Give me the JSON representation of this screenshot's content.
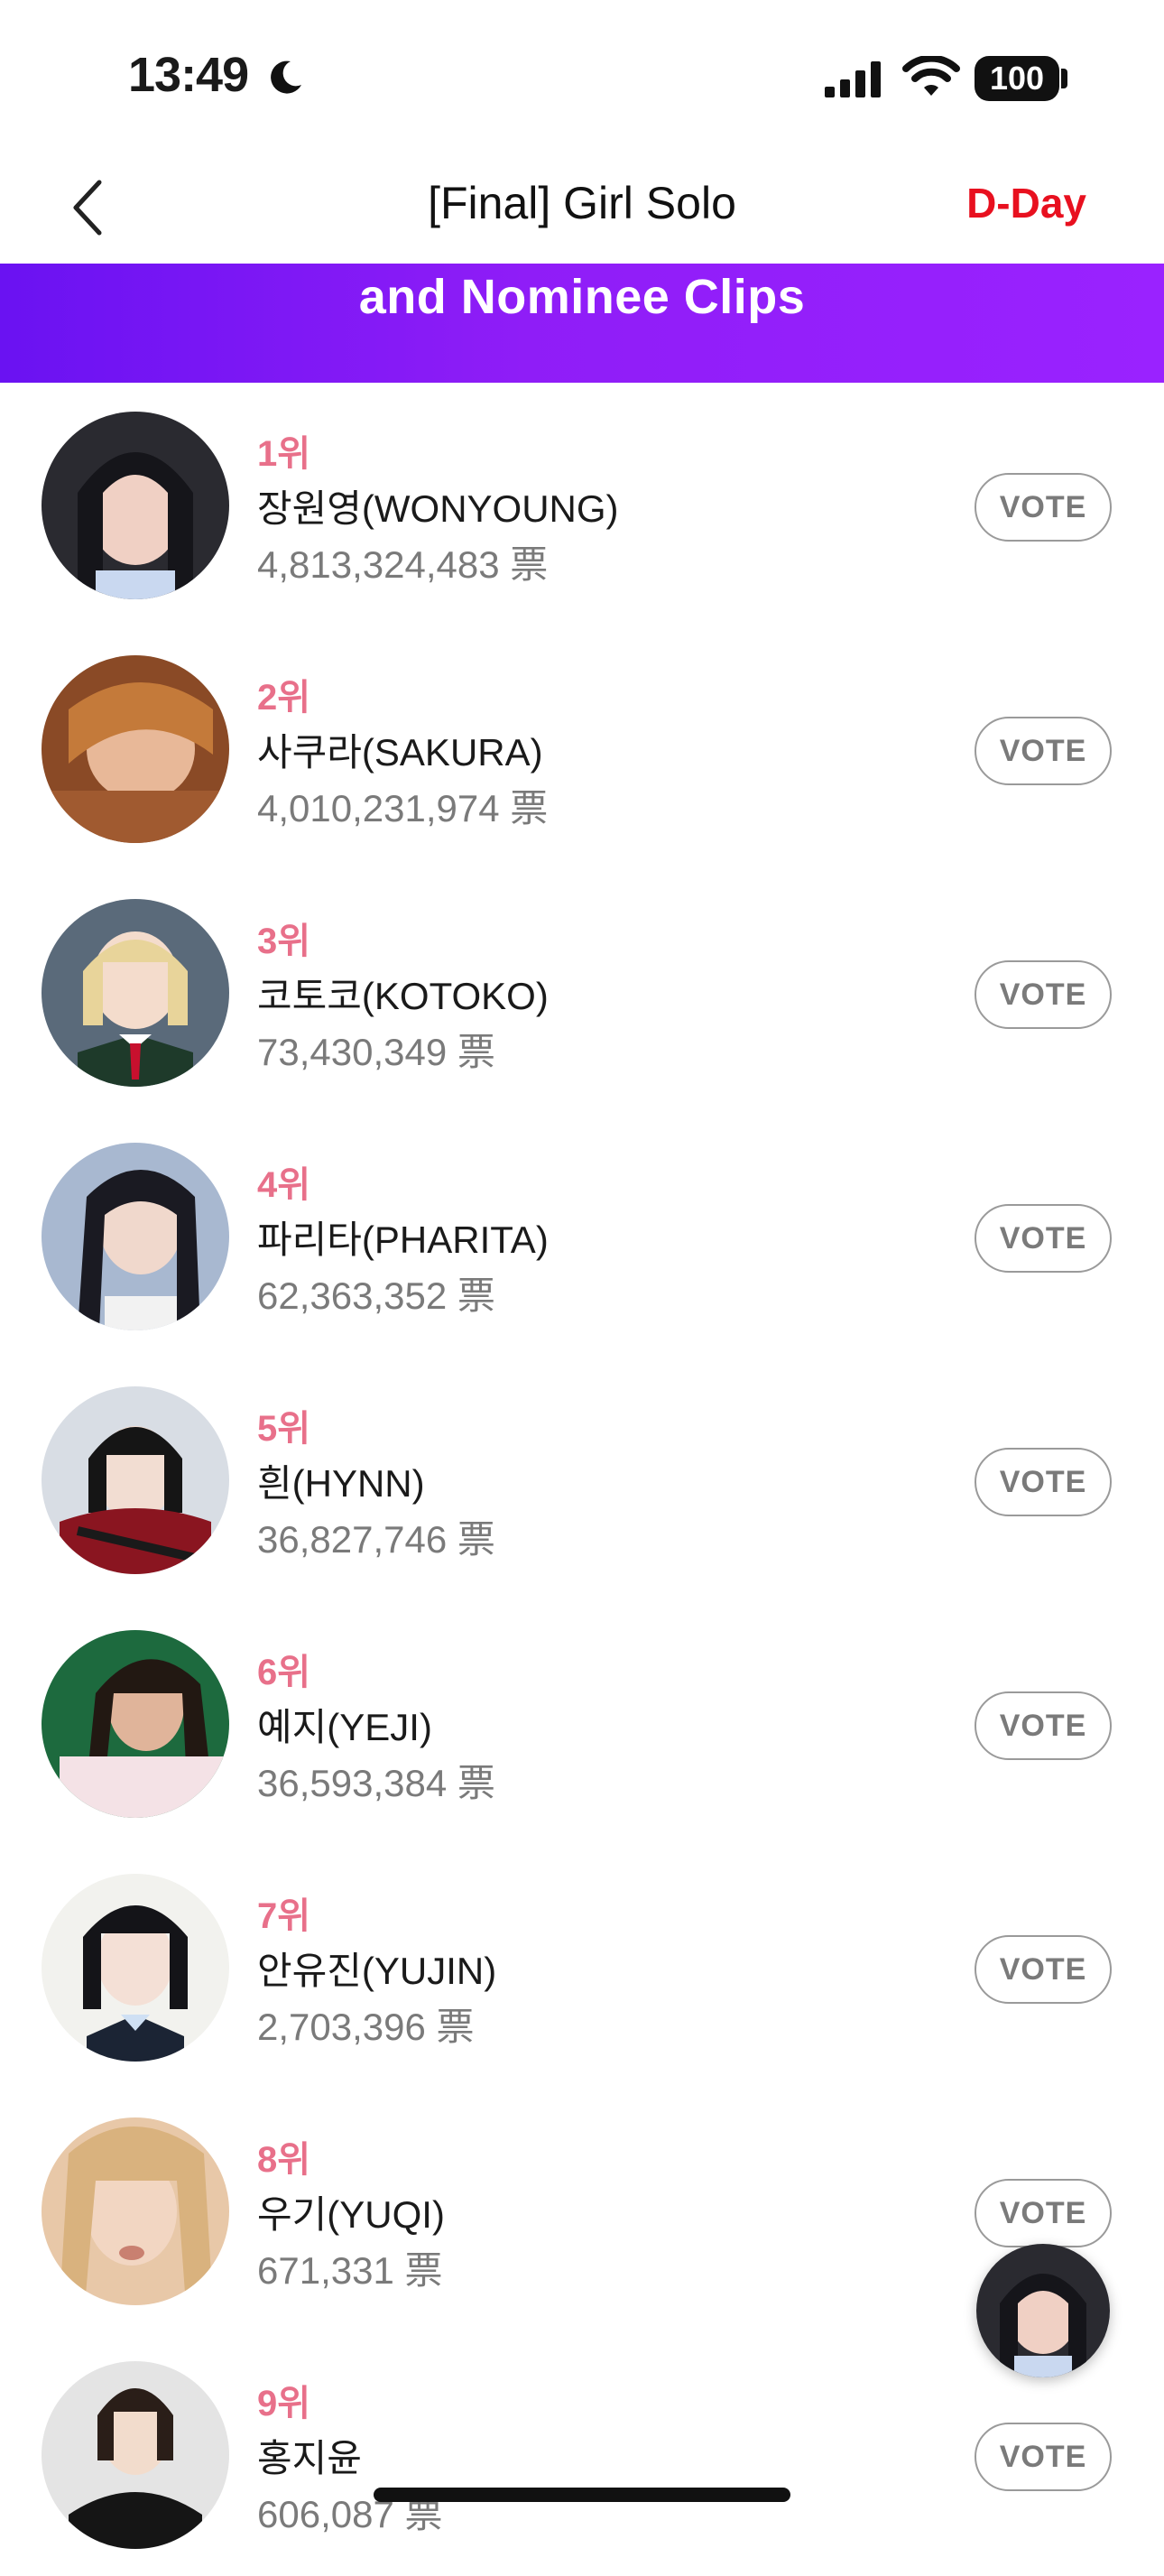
{
  "status": {
    "time": "13:49",
    "battery": "100"
  },
  "nav": {
    "title": "[Final] Girl Solo",
    "dday": "D-Day"
  },
  "banner": {
    "text": "and Nominee Clips"
  },
  "nominees": [
    {
      "rank": "1위",
      "name": "장원영(WONYOUNG)",
      "votes": "4,813,324,483 票",
      "vote_label": "VOTE"
    },
    {
      "rank": "2위",
      "name": "사쿠라(SAKURA)",
      "votes": "4,010,231,974 票",
      "vote_label": "VOTE"
    },
    {
      "rank": "3위",
      "name": "코토코(KOTOKO)",
      "votes": "73,430,349 票",
      "vote_label": "VOTE"
    },
    {
      "rank": "4위",
      "name": "파리타(PHARITA)",
      "votes": "62,363,352 票",
      "vote_label": "VOTE"
    },
    {
      "rank": "5위",
      "name": "흰(HYNN)",
      "votes": "36,827,746 票",
      "vote_label": "VOTE"
    },
    {
      "rank": "6위",
      "name": "예지(YEJI)",
      "votes": "36,593,384 票",
      "vote_label": "VOTE"
    },
    {
      "rank": "7위",
      "name": "안유진(YUJIN)",
      "votes": "2,703,396 票",
      "vote_label": "VOTE"
    },
    {
      "rank": "8위",
      "name": "우기(YUQI)",
      "votes": "671,331 票",
      "vote_label": "VOTE"
    },
    {
      "rank": "9위",
      "name": "홍지윤",
      "votes": "606,087 票",
      "vote_label": "VOTE"
    }
  ],
  "colors": {
    "accent": "#e8101f",
    "rank": "#e8708a",
    "banner_start": "#6a12f2",
    "banner_end": "#9a22ff"
  }
}
